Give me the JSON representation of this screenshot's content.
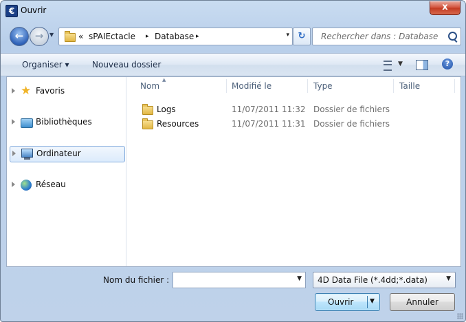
{
  "window": {
    "title": "Ouvrir",
    "app_icon_glyph": "€",
    "close_glyph": "x"
  },
  "address": {
    "prefix": "«",
    "crumbs": [
      "sPAIEctacle",
      "Database"
    ],
    "separator": "▸",
    "dropdown": "▾"
  },
  "nav_buttons": {
    "back_glyph": "←",
    "forward_glyph": "→"
  },
  "search": {
    "placeholder": "Rechercher dans : Database"
  },
  "toolbar": {
    "organize": "Organiser ▾",
    "new_folder": "Nouveau dossier",
    "help": "?"
  },
  "sidebar": {
    "items": [
      {
        "label": "Favoris",
        "icon": "star-icon"
      },
      {
        "label": "Bibliothèques",
        "icon": "libraries-icon"
      },
      {
        "label": "Ordinateur",
        "icon": "computer-icon",
        "selected": true
      },
      {
        "label": "Réseau",
        "icon": "network-icon"
      }
    ]
  },
  "file_list": {
    "columns": [
      "Nom",
      "Modifié le",
      "Type",
      "Taille"
    ],
    "rows": [
      {
        "name": "Logs",
        "modified": "11/07/2011 11:32",
        "type": "Dossier de fichiers",
        "size": ""
      },
      {
        "name": "Resources",
        "modified": "11/07/2011 11:31",
        "type": "Dossier de fichiers",
        "size": ""
      }
    ]
  },
  "footer": {
    "filename_label": "Nom du fichier :",
    "filename_value": "",
    "filter": "4D Data File (*.4dd;*.data)",
    "open": "Ouvrir",
    "cancel": "Annuler"
  }
}
